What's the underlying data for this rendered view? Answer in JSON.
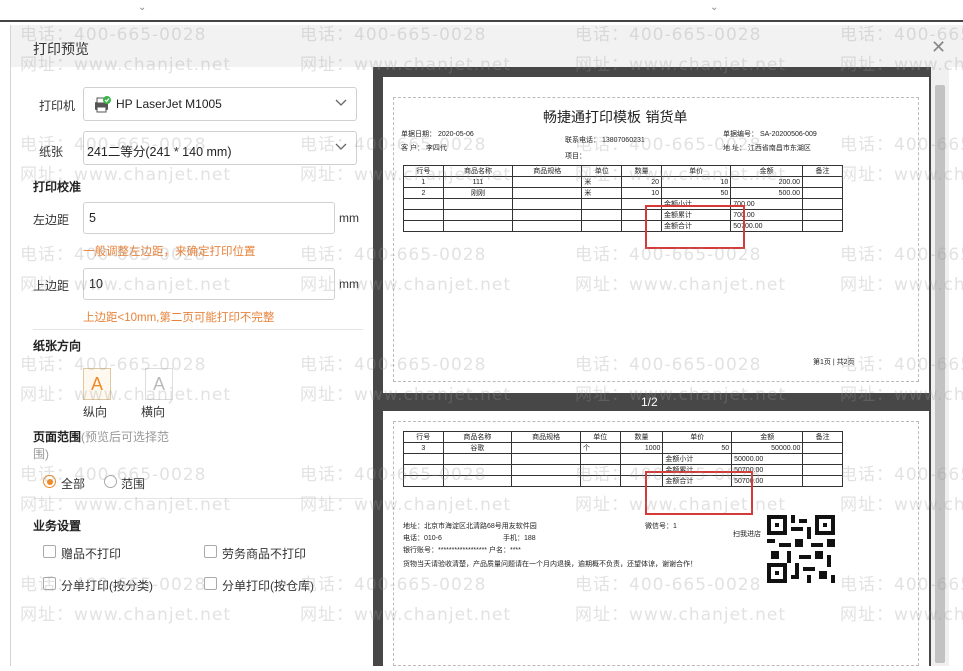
{
  "dialog": {
    "title": "打印预览",
    "close_icon": "close-icon"
  },
  "form": {
    "printer_label": "打印机",
    "printer_value": "HP LaserJet M1005",
    "paper_label": "纸张",
    "paper_value": "241二等分(241 * 140 mm)",
    "calibration_title": "打印校准",
    "left_margin_label": "左边距",
    "left_margin_value": "5",
    "left_margin_unit": "mm",
    "left_margin_hint": "一般调整左边距，来确定打印位置",
    "top_margin_label": "上边距",
    "top_margin_value": "10",
    "top_margin_unit": "mm",
    "top_margin_hint": "上边距<10mm,第二页可能打印不完整",
    "orientation_title": "纸张方向",
    "portrait_label": "纵向",
    "landscape_label": "横向",
    "orientation_glyph": "A",
    "page_range_title": "页面范围",
    "page_range_note": "(预览后可选择范围)",
    "range_all": "全部",
    "range_custom": "范围",
    "business_title": "业务设置",
    "opt1": "赠品不打印",
    "opt2": "劳务商品不打印",
    "opt3": "分单打印(按分类)",
    "opt4": "分单打印(按仓库)"
  },
  "preview": {
    "page_indicator": "1/2",
    "doc_title": "畅捷通打印模板 销货单",
    "header": {
      "date": "单据日期：  2020-05-06",
      "phone": "联系电话：  13807060231",
      "number": "单据编号：  SA-20200506-009",
      "customer": "客    户：  李四代",
      "project": "项目：",
      "address": "地  址：   江西省南昌市东湖区"
    },
    "columns": [
      "行号",
      "商品名称",
      "商品规格",
      "单位",
      "数量",
      "单价",
      "金额",
      "备注"
    ],
    "page1_rows": [
      [
        "1",
        "111",
        "",
        "米",
        "20",
        "10",
        "200.00",
        ""
      ],
      [
        "2",
        "刚刚",
        "",
        "米",
        "10",
        "50",
        "500.00",
        ""
      ]
    ],
    "page1_totals": [
      [
        "金额小计",
        "700.00"
      ],
      [
        "金额累计",
        "700.00"
      ],
      [
        "金额合计",
        "50700.00"
      ]
    ],
    "page1_footer": "第1页 | 共2页",
    "page2_rows": [
      [
        "3",
        "谷歌",
        "",
        "个",
        "1000",
        "50",
        "50000.00",
        ""
      ]
    ],
    "page2_totals": [
      [
        "金额小计",
        "50000.00"
      ],
      [
        "金额累计",
        "50700.00"
      ],
      [
        "金额合计",
        "50700.00"
      ]
    ],
    "footer": {
      "address": "地址：北京市海淀区北清路68号用友软件园",
      "tel": "电话：010-6",
      "mobile": "手机：188",
      "wechat": "微信号：1",
      "bank": "银行账号：******************   户名：****",
      "note": "货物当天请验收清楚，产品质量问题请在一个月内退换，逾期概不负责，还望体谅，谢谢合作！",
      "scan": "扫我进店"
    }
  },
  "watermark": {
    "phone": "电话：400-665-0028",
    "site": "网址：www.chanjet.net"
  },
  "colors": {
    "accent": "#f08a26",
    "hint": "#e8823a",
    "highlight_box": "#d43a3a",
    "preview_bg": "#474747"
  }
}
